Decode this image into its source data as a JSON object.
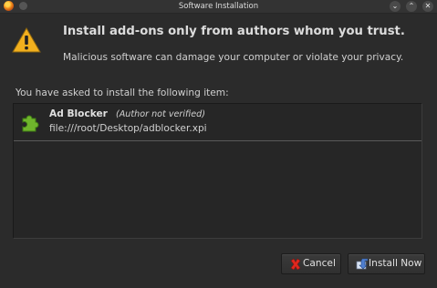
{
  "window": {
    "title": "Software Installation",
    "controls": {
      "minimize": "⌄",
      "maximize": "⌃",
      "close": "✕"
    }
  },
  "dialog": {
    "heading": "Install add-ons only from authors whom you trust.",
    "subtext": "Malicious software can damage your computer or violate your privacy.",
    "list_intro": "You have asked to install the following item:",
    "items": [
      {
        "name": "Ad Blocker",
        "note": "(Author not verified)",
        "path": "file:///root/Desktop/adblocker.xpi",
        "icon": "puzzle-piece-icon"
      }
    ]
  },
  "buttons": {
    "cancel": {
      "label": "Cancel",
      "icon": "red-x-icon"
    },
    "install": {
      "label": "Install Now",
      "icon": "install-icon"
    }
  },
  "colors": {
    "background": "#2b2b2b",
    "warning_yellow": "#f2b01e",
    "puzzle_green": "#6fb52c",
    "cancel_red": "#e0281e",
    "install_blue": "#4f7fd0"
  }
}
